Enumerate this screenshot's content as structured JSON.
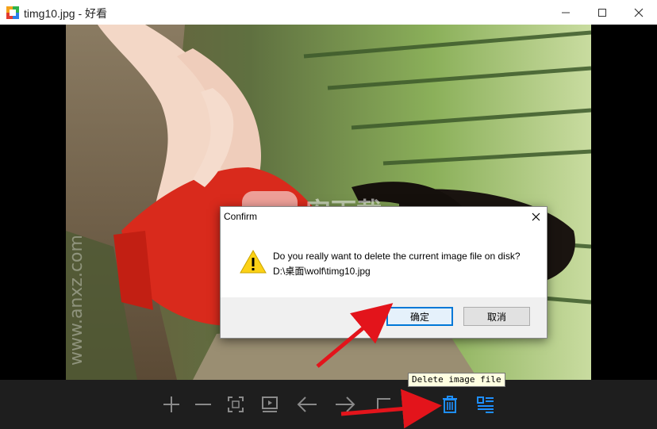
{
  "window": {
    "title": "timg10.jpg - 好看",
    "icons": {
      "app": "app-logo-icon",
      "minimize": "minimize-icon",
      "maximize": "maximize-icon",
      "close": "close-icon"
    }
  },
  "dialog": {
    "title": "Confirm",
    "message": "Do you really want to delete the current image file on disk?",
    "path": "D:\\桌面\\wolf\\timg10.jpg",
    "ok_label": "确定",
    "cancel_label": "取消",
    "icons": {
      "warning": "warning-icon",
      "close": "close-icon"
    }
  },
  "tooltip": {
    "text": "Delete image file"
  },
  "toolbar": {
    "items": [
      {
        "name": "zoom-in-icon"
      },
      {
        "name": "zoom-out-icon"
      },
      {
        "name": "fit-screen-icon"
      },
      {
        "name": "slideshow-icon"
      },
      {
        "name": "previous-icon"
      },
      {
        "name": "next-icon"
      },
      {
        "name": "rotate-left-icon"
      },
      {
        "name": "rotate-right-icon"
      },
      {
        "name": "trash-icon"
      },
      {
        "name": "menu-icon"
      }
    ]
  },
  "watermark": {
    "text": "安下载",
    "subtext": "anxz.com"
  },
  "colors": {
    "accent": "#1e8fff",
    "toolbar_bg": "#1e1e1e",
    "arrow": "#e3141b",
    "ok_border": "#0078d7"
  }
}
